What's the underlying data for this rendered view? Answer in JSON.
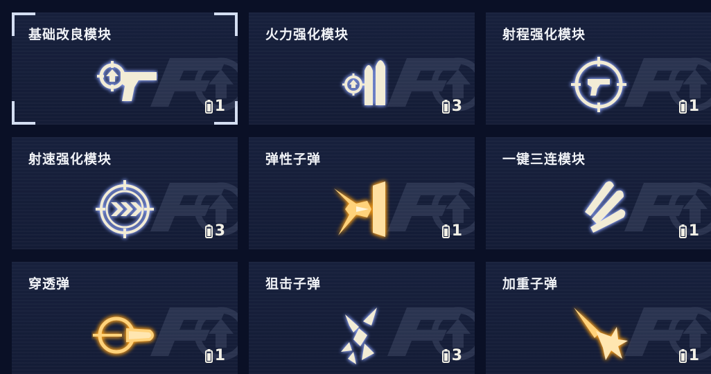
{
  "modules": [
    {
      "name": "基础改良模块",
      "count": "1",
      "icon": "pistol-target-upgrade-icon",
      "rarity": "white",
      "selected": true
    },
    {
      "name": "火力强化模块",
      "count": "3",
      "icon": "bullets-upgrade-icon",
      "rarity": "white",
      "selected": false
    },
    {
      "name": "射程强化模块",
      "count": "1",
      "icon": "scope-pistol-icon",
      "rarity": "white",
      "selected": false
    },
    {
      "name": "射速强化模块",
      "count": "3",
      "icon": "scope-chevrons-icon",
      "rarity": "white",
      "selected": false
    },
    {
      "name": "弹性子弹",
      "count": "1",
      "icon": "bouncing-bullet-icon",
      "rarity": "gold",
      "selected": false
    },
    {
      "name": "一键三连模块",
      "count": "1",
      "icon": "triple-bullet-icon",
      "rarity": "white",
      "selected": false
    },
    {
      "name": "穿透弹",
      "count": "1",
      "icon": "piercing-bullet-icon",
      "rarity": "gold",
      "selected": false
    },
    {
      "name": "狙击子弹",
      "count": "3",
      "icon": "sniper-bullet-icon",
      "rarity": "white",
      "selected": false
    },
    {
      "name": "加重子弹",
      "count": "1",
      "icon": "heavy-bullet-icon",
      "rarity": "gold",
      "selected": false
    }
  ],
  "colors": {
    "background": "#0a1026",
    "card": "#161e3a",
    "title": "#f1f3f7",
    "icon_white": "#f2ecd6",
    "icon_gold": "#ffb23a",
    "glow_white": "#9fb4ff",
    "selection_corner": "#d4def2"
  }
}
